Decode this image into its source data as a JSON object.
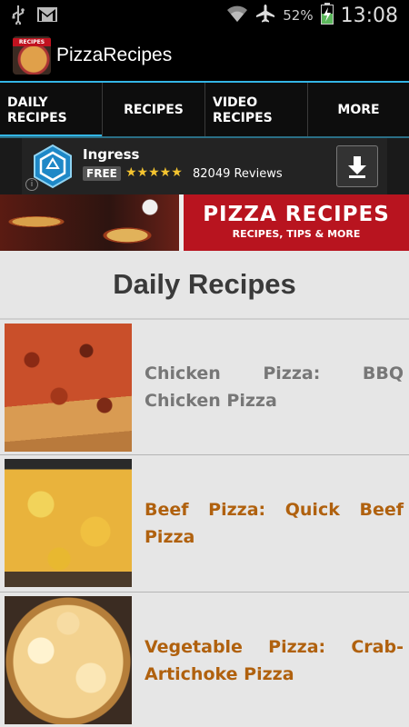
{
  "status_bar": {
    "icons": [
      "usb-icon",
      "gmail-icon",
      "wifi-icon",
      "airplane-icon",
      "battery-charging-icon"
    ],
    "battery": "52%",
    "time": "13:08"
  },
  "app_bar": {
    "logo_text": "RECIPES",
    "title": "PizzaRecipes"
  },
  "tabs": [
    {
      "label": "DAILY RECIPES",
      "active": true
    },
    {
      "label": "RECIPES",
      "active": false
    },
    {
      "label": "VIDEO RECIPES",
      "active": false
    },
    {
      "label": "MORE",
      "active": false
    }
  ],
  "ad": {
    "info_glyph": "i",
    "app_name": "Ingress",
    "price_badge": "FREE",
    "stars": "★★★★★",
    "rating": 4.5,
    "reviews": "82049 Reviews",
    "accent": "#2aa7d8"
  },
  "hero": {
    "title": "PIZZA RECIPES",
    "subtitle": "RECIPES, TIPS & MORE"
  },
  "main": {
    "section_title": "Daily Recipes",
    "items": [
      {
        "title": "Chicken Pizza: BBQ Chicken Pizza",
        "state": "read",
        "color": "#777777"
      },
      {
        "title": "Beef Pizza: Quick Beef Pizza",
        "state": "unread",
        "color": "#b0610e"
      },
      {
        "title": "Vegetable Pizza: Crab-Artichoke Pizza",
        "state": "unread",
        "color": "#b0610e"
      }
    ]
  },
  "colors": {
    "accent": "#33b5e5",
    "hero_red": "#b8141f",
    "list_bg": "#e6e6e6"
  }
}
